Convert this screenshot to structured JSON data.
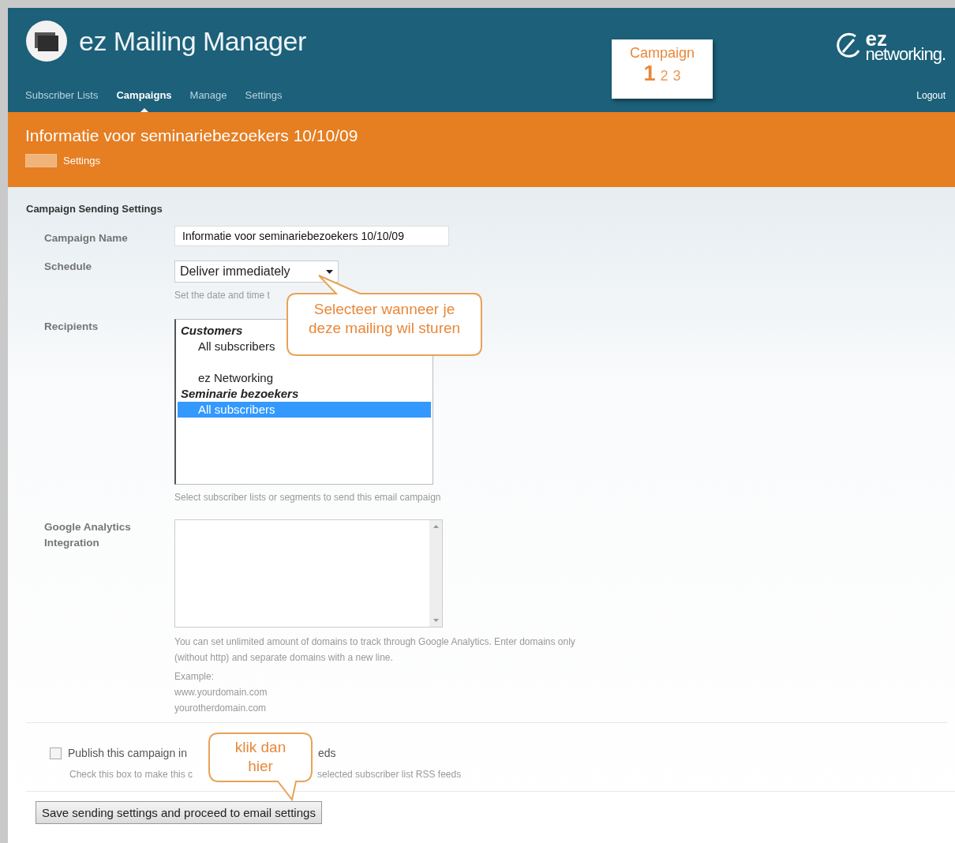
{
  "header": {
    "app_title": "ez Mailing Manager",
    "nav": [
      {
        "label": "Subscriber Lists",
        "selected": false
      },
      {
        "label": "Campaigns",
        "selected": true
      },
      {
        "label": "Manage",
        "selected": false
      },
      {
        "label": "Settings",
        "selected": false
      }
    ],
    "steps": {
      "title": "Campaign",
      "items": [
        {
          "label": "1",
          "selected": true
        },
        {
          "label": "2",
          "selected": false
        },
        {
          "label": "3",
          "selected": false
        }
      ]
    },
    "brand": {
      "mark": "ez",
      "name": "networking."
    },
    "logout": "Logout"
  },
  "campaign_bar": {
    "title": "Informatie voor seminariebezoekers 10/10/09",
    "settings_link": "Settings"
  },
  "form": {
    "section_title": "Campaign Sending Settings",
    "campaign_name": {
      "label": "Campaign Name",
      "value": "Informatie voor seminariebezoekers 10/10/09"
    },
    "schedule": {
      "label": "Schedule",
      "value": "Deliver immediately",
      "hint": "Set the date and time t"
    },
    "recipients": {
      "label": "Recipients",
      "options": [
        {
          "kind": "group",
          "label": "Customers",
          "selected": false
        },
        {
          "kind": "option",
          "label": "All subscribers",
          "selected": false
        },
        {
          "kind": "blank",
          "selected": false
        },
        {
          "kind": "option",
          "label": "ez Networking",
          "selected": false
        },
        {
          "kind": "group",
          "label": "Seminarie bezoekers",
          "selected": false
        },
        {
          "kind": "option",
          "label": "All subscribers",
          "selected": true
        }
      ],
      "hint": "Select subscriber lists or segments to send this email campaign"
    },
    "analytics": {
      "label": "Google Analytics Integration",
      "hint_lines": [
        "You can set unlimited amount of domains to track through Google Analytics. Enter domains only (without http) and separate domains with a new line.",
        "Example:",
        "www.yourdomain.com",
        "yourotherdomain.com"
      ]
    },
    "publish": {
      "checked": false,
      "label_start": "Publish this campaign in",
      "label_end": "eds",
      "hint_start": "Check this box to make this c",
      "hint_end": "selected subscriber list RSS feeds"
    },
    "submit": "Save sending settings and proceed to email settings"
  },
  "callouts": [
    {
      "lines": [
        "Selecteer wanneer je",
        "deze mailing wil sturen"
      ]
    },
    {
      "lines": [
        "klik dan",
        "hier"
      ]
    }
  ]
}
